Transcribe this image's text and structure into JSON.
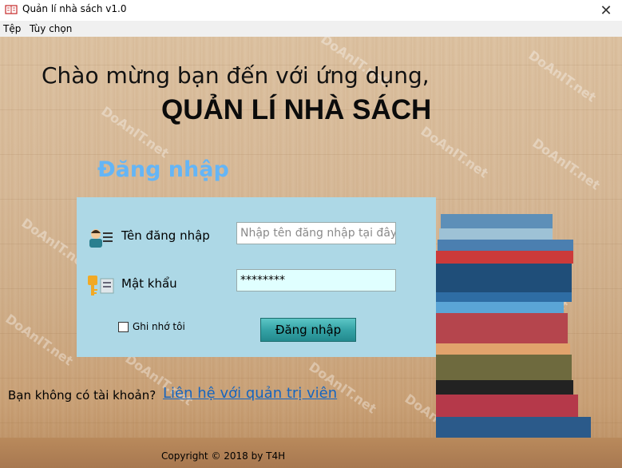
{
  "window": {
    "title": "Quản lí nhà sách v1.0",
    "close_symbol": "✕"
  },
  "menu": {
    "items": [
      "Tệp",
      "Tùy chọn"
    ]
  },
  "watermark": "DoAnIT.net",
  "greeting": "Chào mừng bạn đến với ứng dụng,",
  "app_name": "QUẢN LÍ NHÀ SÁCH",
  "login": {
    "heading": "Đăng nhập",
    "username_label": "Tên đăng nhập",
    "username_placeholder": "Nhập tên đăng nhập tại đây",
    "password_label": "Mật khẩu",
    "password_value": "********",
    "remember_label": "Ghi nhớ tôi",
    "remember_checked": false,
    "submit_label": "Đăng nhập"
  },
  "footer": {
    "no_account_text": "Bạn không có tài khoản?",
    "contact_link": "Liên hệ với quản trị viên",
    "copyright": "Copyright © 2018 by T4H"
  },
  "colors": {
    "panel": "#add8e6",
    "heading": "#64b5f6",
    "link": "#1565c0",
    "input_bg": "#e0ffff"
  },
  "icons": [
    "book-app-icon",
    "user-card-icon",
    "key-icon",
    "close-icon"
  ]
}
